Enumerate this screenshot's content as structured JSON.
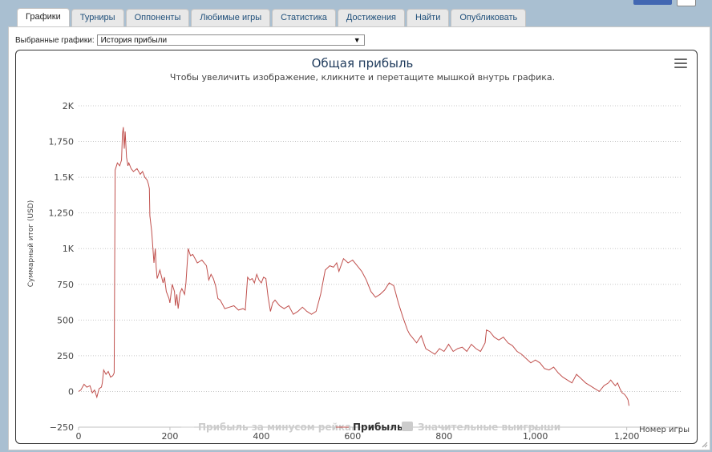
{
  "tabs": [
    {
      "label": "Графики",
      "active": true
    },
    {
      "label": "Турниры",
      "active": false
    },
    {
      "label": "Оппоненты",
      "active": false
    },
    {
      "label": "Любимые игры",
      "active": false
    },
    {
      "label": "Статистика",
      "active": false
    },
    {
      "label": "Достижения",
      "active": false
    },
    {
      "label": "Найти",
      "active": false
    },
    {
      "label": "Опубликовать",
      "active": false
    }
  ],
  "selector": {
    "label": "Выбранные графики:",
    "value": "История прибыли"
  },
  "colors": {
    "line": "#c0504d",
    "grid": "#c8c8c8",
    "title": "#1f3b5c",
    "legend_inactive": "#cccccc",
    "legend_active": "#333333",
    "tab_text": "#1f4f7a"
  },
  "chart_data": {
    "type": "line",
    "title": "Общая прибыль",
    "subtitle": "Чтобы увеличить изображение, кликните и перетащите мышкой внутрь графика.",
    "ylabel": "Суммарный итог (USD)",
    "xlabel": "Номер игры",
    "xlim": [
      0,
      1320
    ],
    "ylim": [
      -250,
      2000
    ],
    "grid": true,
    "y_ticks": [
      {
        "v": 2000,
        "label": "2K"
      },
      {
        "v": 1750,
        "label": "1,750"
      },
      {
        "v": 1500,
        "label": "1.5K"
      },
      {
        "v": 1250,
        "label": "1,250"
      },
      {
        "v": 1000,
        "label": "1K"
      },
      {
        "v": 750,
        "label": "750"
      },
      {
        "v": 500,
        "label": "500"
      },
      {
        "v": 250,
        "label": "250"
      },
      {
        "v": 0,
        "label": "0"
      },
      {
        "v": -250,
        "label": "−250"
      }
    ],
    "x_ticks": [
      {
        "v": 0,
        "label": "0"
      },
      {
        "v": 200,
        "label": "200"
      },
      {
        "v": 400,
        "label": "400"
      },
      {
        "v": 600,
        "label": "600"
      },
      {
        "v": 800,
        "label": "800"
      },
      {
        "v": 1000,
        "label": "1,000"
      },
      {
        "v": 1200,
        "label": "1,200"
      }
    ],
    "legend": [
      {
        "name": "Прибыль за минусом рейка",
        "active": false,
        "marker": "line"
      },
      {
        "name": "Прибыль",
        "active": true,
        "marker": "line"
      },
      {
        "name": "Значительные выигрыши",
        "active": false,
        "marker": "box"
      }
    ],
    "series": [
      {
        "name": "Прибыль",
        "values": [
          [
            0,
            0
          ],
          [
            5,
            10
          ],
          [
            12,
            50
          ],
          [
            18,
            30
          ],
          [
            25,
            40
          ],
          [
            30,
            -10
          ],
          [
            35,
            10
          ],
          [
            40,
            -40
          ],
          [
            45,
            20
          ],
          [
            50,
            30
          ],
          [
            52,
            60
          ],
          [
            55,
            150
          ],
          [
            60,
            120
          ],
          [
            65,
            140
          ],
          [
            70,
            100
          ],
          [
            75,
            110
          ],
          [
            78,
            130
          ],
          [
            80,
            1550
          ],
          [
            85,
            1600
          ],
          [
            90,
            1580
          ],
          [
            94,
            1620
          ],
          [
            96,
            1800
          ],
          [
            98,
            1850
          ],
          [
            100,
            1700
          ],
          [
            102,
            1820
          ],
          [
            105,
            1640
          ],
          [
            108,
            1580
          ],
          [
            110,
            1600
          ],
          [
            115,
            1560
          ],
          [
            120,
            1540
          ],
          [
            128,
            1560
          ],
          [
            135,
            1520
          ],
          [
            140,
            1540
          ],
          [
            145,
            1500
          ],
          [
            150,
            1480
          ],
          [
            153,
            1450
          ],
          [
            155,
            1420
          ],
          [
            156,
            1230
          ],
          [
            160,
            1120
          ],
          [
            165,
            900
          ],
          [
            168,
            1000
          ],
          [
            170,
            870
          ],
          [
            172,
            790
          ],
          [
            178,
            850
          ],
          [
            185,
            760
          ],
          [
            188,
            800
          ],
          [
            192,
            700
          ],
          [
            198,
            650
          ],
          [
            200,
            620
          ],
          [
            205,
            750
          ],
          [
            210,
            700
          ],
          [
            212,
            600
          ],
          [
            215,
            680
          ],
          [
            218,
            580
          ],
          [
            222,
            690
          ],
          [
            226,
            720
          ],
          [
            232,
            680
          ],
          [
            235,
            760
          ],
          [
            240,
            1000
          ],
          [
            245,
            950
          ],
          [
            250,
            960
          ],
          [
            255,
            930
          ],
          [
            260,
            900
          ],
          [
            270,
            920
          ],
          [
            280,
            880
          ],
          [
            285,
            780
          ],
          [
            290,
            820
          ],
          [
            295,
            790
          ],
          [
            300,
            740
          ],
          [
            305,
            650
          ],
          [
            310,
            640
          ],
          [
            315,
            610
          ],
          [
            320,
            580
          ],
          [
            330,
            590
          ],
          [
            340,
            600
          ],
          [
            350,
            570
          ],
          [
            360,
            580
          ],
          [
            365,
            570
          ],
          [
            370,
            800
          ],
          [
            375,
            780
          ],
          [
            380,
            790
          ],
          [
            385,
            760
          ],
          [
            390,
            820
          ],
          [
            395,
            780
          ],
          [
            400,
            760
          ],
          [
            405,
            800
          ],
          [
            410,
            790
          ],
          [
            415,
            660
          ],
          [
            420,
            560
          ],
          [
            425,
            620
          ],
          [
            430,
            640
          ],
          [
            440,
            600
          ],
          [
            450,
            580
          ],
          [
            460,
            600
          ],
          [
            470,
            540
          ],
          [
            480,
            560
          ],
          [
            490,
            590
          ],
          [
            500,
            560
          ],
          [
            510,
            540
          ],
          [
            520,
            560
          ],
          [
            530,
            680
          ],
          [
            540,
            850
          ],
          [
            550,
            880
          ],
          [
            558,
            870
          ],
          [
            565,
            900
          ],
          [
            570,
            840
          ],
          [
            580,
            930
          ],
          [
            590,
            900
          ],
          [
            600,
            920
          ],
          [
            610,
            880
          ],
          [
            620,
            840
          ],
          [
            630,
            780
          ],
          [
            640,
            700
          ],
          [
            650,
            660
          ],
          [
            660,
            680
          ],
          [
            670,
            710
          ],
          [
            680,
            760
          ],
          [
            690,
            740
          ],
          [
            700,
            620
          ],
          [
            710,
            520
          ],
          [
            720,
            430
          ],
          [
            725,
            400
          ],
          [
            730,
            380
          ],
          [
            740,
            340
          ],
          [
            750,
            390
          ],
          [
            760,
            300
          ],
          [
            770,
            280
          ],
          [
            780,
            260
          ],
          [
            790,
            300
          ],
          [
            800,
            280
          ],
          [
            810,
            330
          ],
          [
            820,
            280
          ],
          [
            830,
            300
          ],
          [
            840,
            310
          ],
          [
            850,
            280
          ],
          [
            860,
            330
          ],
          [
            870,
            300
          ],
          [
            880,
            280
          ],
          [
            890,
            340
          ],
          [
            893,
            430
          ],
          [
            900,
            420
          ],
          [
            910,
            380
          ],
          [
            920,
            360
          ],
          [
            930,
            380
          ],
          [
            940,
            340
          ],
          [
            950,
            320
          ],
          [
            960,
            280
          ],
          [
            970,
            260
          ],
          [
            980,
            230
          ],
          [
            990,
            200
          ],
          [
            1000,
            220
          ],
          [
            1010,
            200
          ],
          [
            1020,
            160
          ],
          [
            1030,
            150
          ],
          [
            1040,
            170
          ],
          [
            1050,
            130
          ],
          [
            1060,
            100
          ],
          [
            1070,
            80
          ],
          [
            1080,
            60
          ],
          [
            1090,
            120
          ],
          [
            1100,
            90
          ],
          [
            1110,
            60
          ],
          [
            1120,
            40
          ],
          [
            1130,
            20
          ],
          [
            1140,
            0
          ],
          [
            1150,
            40
          ],
          [
            1160,
            60
          ],
          [
            1165,
            80
          ],
          [
            1170,
            60
          ],
          [
            1175,
            40
          ],
          [
            1180,
            60
          ],
          [
            1185,
            20
          ],
          [
            1190,
            -10
          ],
          [
            1195,
            -20
          ],
          [
            1200,
            -40
          ],
          [
            1203,
            -60
          ],
          [
            1205,
            -100
          ]
        ]
      }
    ]
  }
}
